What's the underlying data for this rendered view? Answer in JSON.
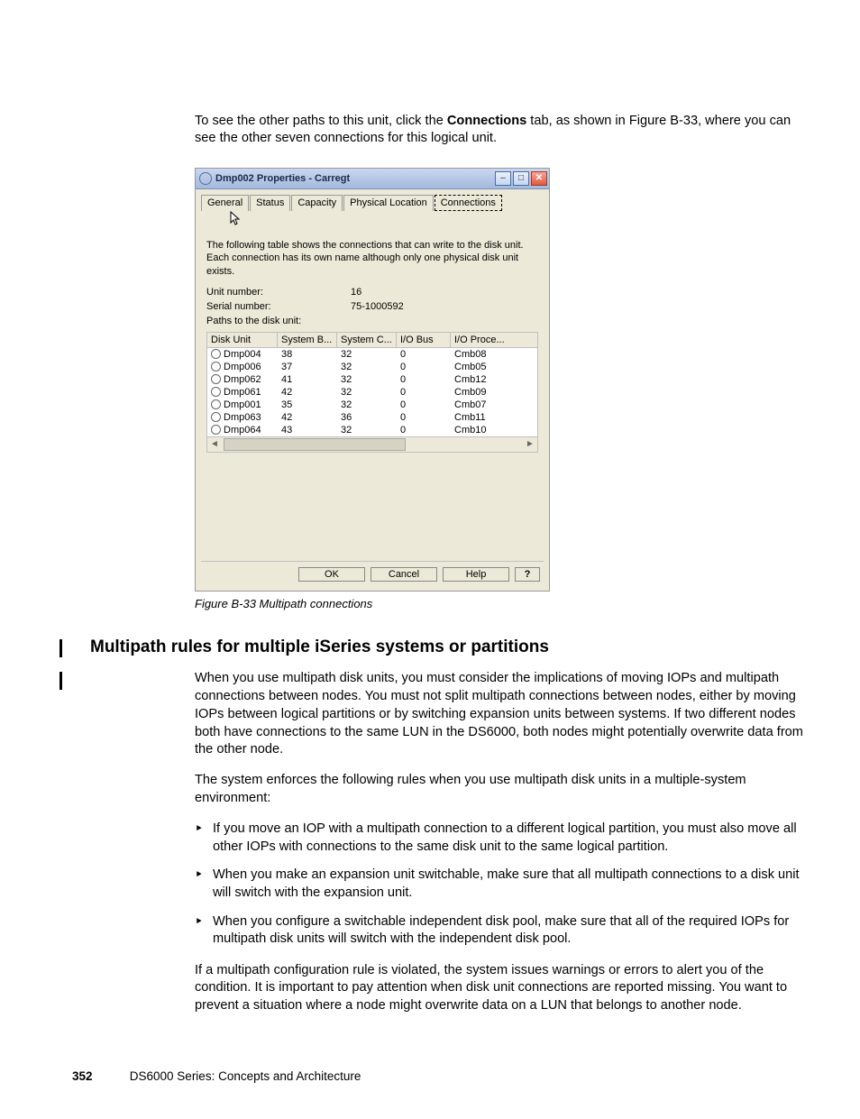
{
  "intro": {
    "pre": "To see the other paths to this unit, click the ",
    "bold": "Connections",
    "post": " tab, as shown in Figure B-33, where you can see the other seven connections for this logical unit."
  },
  "dialog": {
    "title": "Dmp002 Properties - Carregt",
    "tabs": [
      "General",
      "Status",
      "Capacity",
      "Physical Location",
      "Connections"
    ],
    "desc": "The following table shows the connections that can write to the disk unit.  Each connection has its own name although only one physical disk unit exists.",
    "unit_label": "Unit number:",
    "unit_value": "16",
    "serial_label": "Serial number:",
    "serial_value": "75-1000592",
    "paths_label": "Paths to the disk unit:",
    "headers": [
      "Disk Unit",
      "System B...",
      "System C...",
      "I/O Bus",
      "I/O Proce..."
    ],
    "rows": [
      {
        "disk": "Dmp004",
        "b": "38",
        "c": "32",
        "bus": "0",
        "proc": "Cmb08"
      },
      {
        "disk": "Dmp006",
        "b": "37",
        "c": "32",
        "bus": "0",
        "proc": "Cmb05"
      },
      {
        "disk": "Dmp062",
        "b": "41",
        "c": "32",
        "bus": "0",
        "proc": "Cmb12"
      },
      {
        "disk": "Dmp061",
        "b": "42",
        "c": "32",
        "bus": "0",
        "proc": "Cmb09"
      },
      {
        "disk": "Dmp001",
        "b": "35",
        "c": "32",
        "bus": "0",
        "proc": "Cmb07"
      },
      {
        "disk": "Dmp063",
        "b": "42",
        "c": "36",
        "bus": "0",
        "proc": "Cmb11"
      },
      {
        "disk": "Dmp064",
        "b": "43",
        "c": "32",
        "bus": "0",
        "proc": "Cmb10"
      }
    ],
    "ok": "OK",
    "cancel": "Cancel",
    "help": "Help",
    "q": "?"
  },
  "figure_caption": "Figure B-33   Multipath connections",
  "section_heading": "Multipath rules for multiple iSeries systems or partitions",
  "para1": "When you use multipath disk units, you must consider the implications of moving IOPs and multipath connections between nodes. You must not split multipath connections between nodes, either by moving IOPs between logical partitions or by switching expansion units between systems. If two different nodes both have connections to the same LUN in the DS6000, both nodes might potentially overwrite data from the other node.",
  "para2": "The system enforces the following rules when you use multipath disk units in a multiple-system environment:",
  "bullets": [
    "If you move an IOP with a multipath connection to a different logical partition, you must also move all other IOPs with connections to the same disk unit to the same logical partition.",
    "When you make an expansion unit switchable, make sure that all multipath connections to a disk unit will switch with the expansion unit.",
    "When you configure a switchable independent disk pool, make sure that all of the required IOPs for multipath disk units will switch with the independent disk pool."
  ],
  "para3": "If a multipath configuration rule is violated, the system issues warnings or errors to alert you of the condition. It is important to pay attention when disk unit connections are reported missing. You want to prevent a situation where a node might overwrite data on a LUN that belongs to another node.",
  "footer": {
    "page": "352",
    "title": "DS6000 Series: Concepts and Architecture"
  }
}
